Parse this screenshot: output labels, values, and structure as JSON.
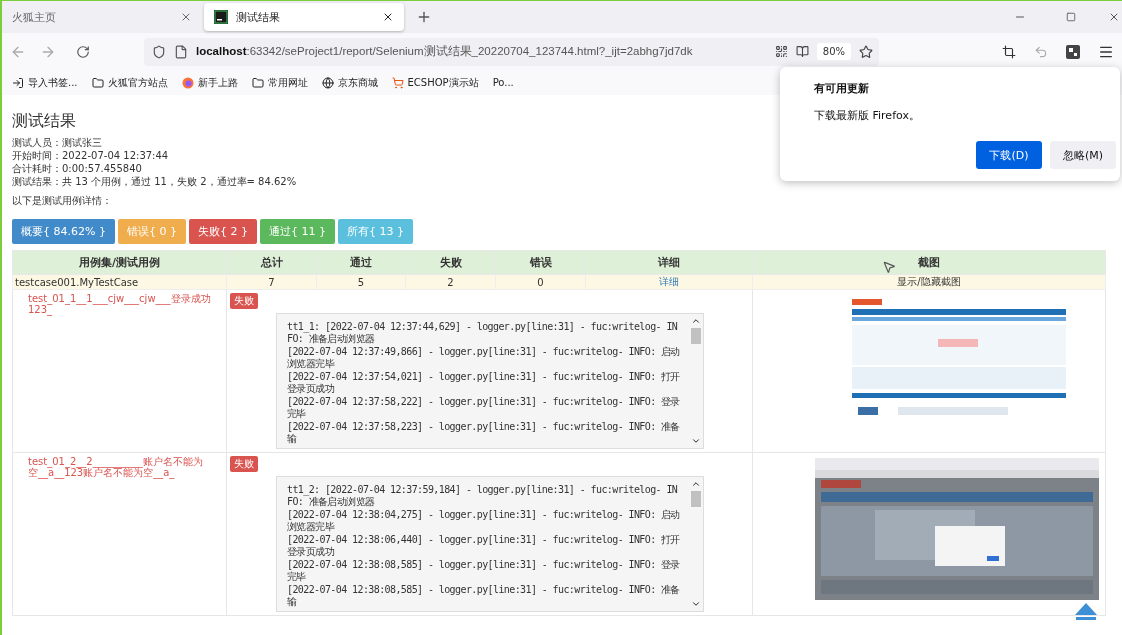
{
  "browser": {
    "tabs": [
      {
        "title": "火狐主页",
        "selected": false
      },
      {
        "title": "测试结果",
        "selected": true
      }
    ],
    "address": {
      "host": "localhost",
      "path": ":63342/seProject1/report/Selenium测试结果_20220704_123744.html?_ijt=2abhg7jd7dk"
    },
    "zoom": "80%",
    "bookmarks": [
      {
        "label": "导入书签...",
        "kind": "import"
      },
      {
        "label": "火狐官方站点",
        "kind": "folder"
      },
      {
        "label": "新手上路",
        "kind": "firefox"
      },
      {
        "label": "常用网址",
        "kind": "folder"
      },
      {
        "label": "京东商城",
        "kind": "globe"
      },
      {
        "label": "ECSHOP演示站",
        "kind": "cart"
      },
      {
        "label": "Po...",
        "kind": "plain"
      }
    ]
  },
  "report": {
    "title": "测试结果",
    "info": [
      "测试人员：测试张三",
      "开始时间：2022-07-04 12:37:44",
      "合计耗时：0:00:57.455840",
      "测试结果：共 13 个用例，通过 11，失败 2，通过率= 84.62%",
      "以下是测试用例详情："
    ],
    "filters": [
      {
        "label": "概要{ 84.62% }",
        "color": "#428bca"
      },
      {
        "label": "错误{ 0 }",
        "color": "#f0ad4e"
      },
      {
        "label": "失败{ 2 }",
        "color": "#d9534f"
      },
      {
        "label": "通过{ 11 }",
        "color": "#5cb85c"
      },
      {
        "label": "所有{ 13 }",
        "color": "#5bc0de"
      }
    ],
    "columns": [
      "用例集/测试用例",
      "总计",
      "通过",
      "失败",
      "错误",
      "详细",
      "截图"
    ],
    "summary": {
      "name": "testcase001.MyTestCase",
      "total": "7",
      "passed": "5",
      "failed": "2",
      "errors": "0",
      "detail": "详细",
      "screenshots": "显示/隐藏截图"
    },
    "tests": [
      {
        "name": "test_01_1__1___cjw___cjw___登录成功123_",
        "status": "失败",
        "log": [
          "tt1_1: [2022-07-04 12:37:44,629] - logger.py[line:31] - fuc:writelog- INFO: 准备启动浏览器",
          "[2022-07-04 12:37:49,866] - logger.py[line:31] - fuc:writelog- INFO: 启动浏览器完毕",
          "[2022-07-04 12:37:54,021] - logger.py[line:31] - fuc:writelog- INFO: 打开登录页成功",
          "[2022-07-04 12:37:58,222] - logger.py[line:31] - fuc:writelog- INFO: 登录完毕",
          "[2022-07-04 12:37:58,223] - logger.py[line:31] - fuc:writelog- INFO: 准备输"
        ]
      },
      {
        "name": "test_01_2__2__________账户名不能为空__a__123账户名不能为空__a_",
        "status": "失败",
        "log": [
          "tt1_2: [2022-07-04 12:37:59,184] - logger.py[line:31] - fuc:writelog- INFO: 准备启动浏览器",
          "[2022-07-04 12:38:04,275] - logger.py[line:31] - fuc:writelog- INFO: 启动浏览器完毕",
          "[2022-07-04 12:38:06,440] - logger.py[line:31] - fuc:writelog- INFO: 打开登录页成功",
          "[2022-07-04 12:38:08,585] - logger.py[line:31] - fuc:writelog- INFO: 登录完毕",
          "[2022-07-04 12:38:08,585] - logger.py[line:31] - fuc:writelog- INFO: 准备输"
        ]
      }
    ]
  },
  "update_popup": {
    "title": "有可用更新",
    "message": "下载最新版 Firefox。",
    "buttons": [
      {
        "label": "下载(D)",
        "kind": "primary"
      },
      {
        "label": "忽略(M)",
        "kind": "secondary"
      }
    ]
  }
}
